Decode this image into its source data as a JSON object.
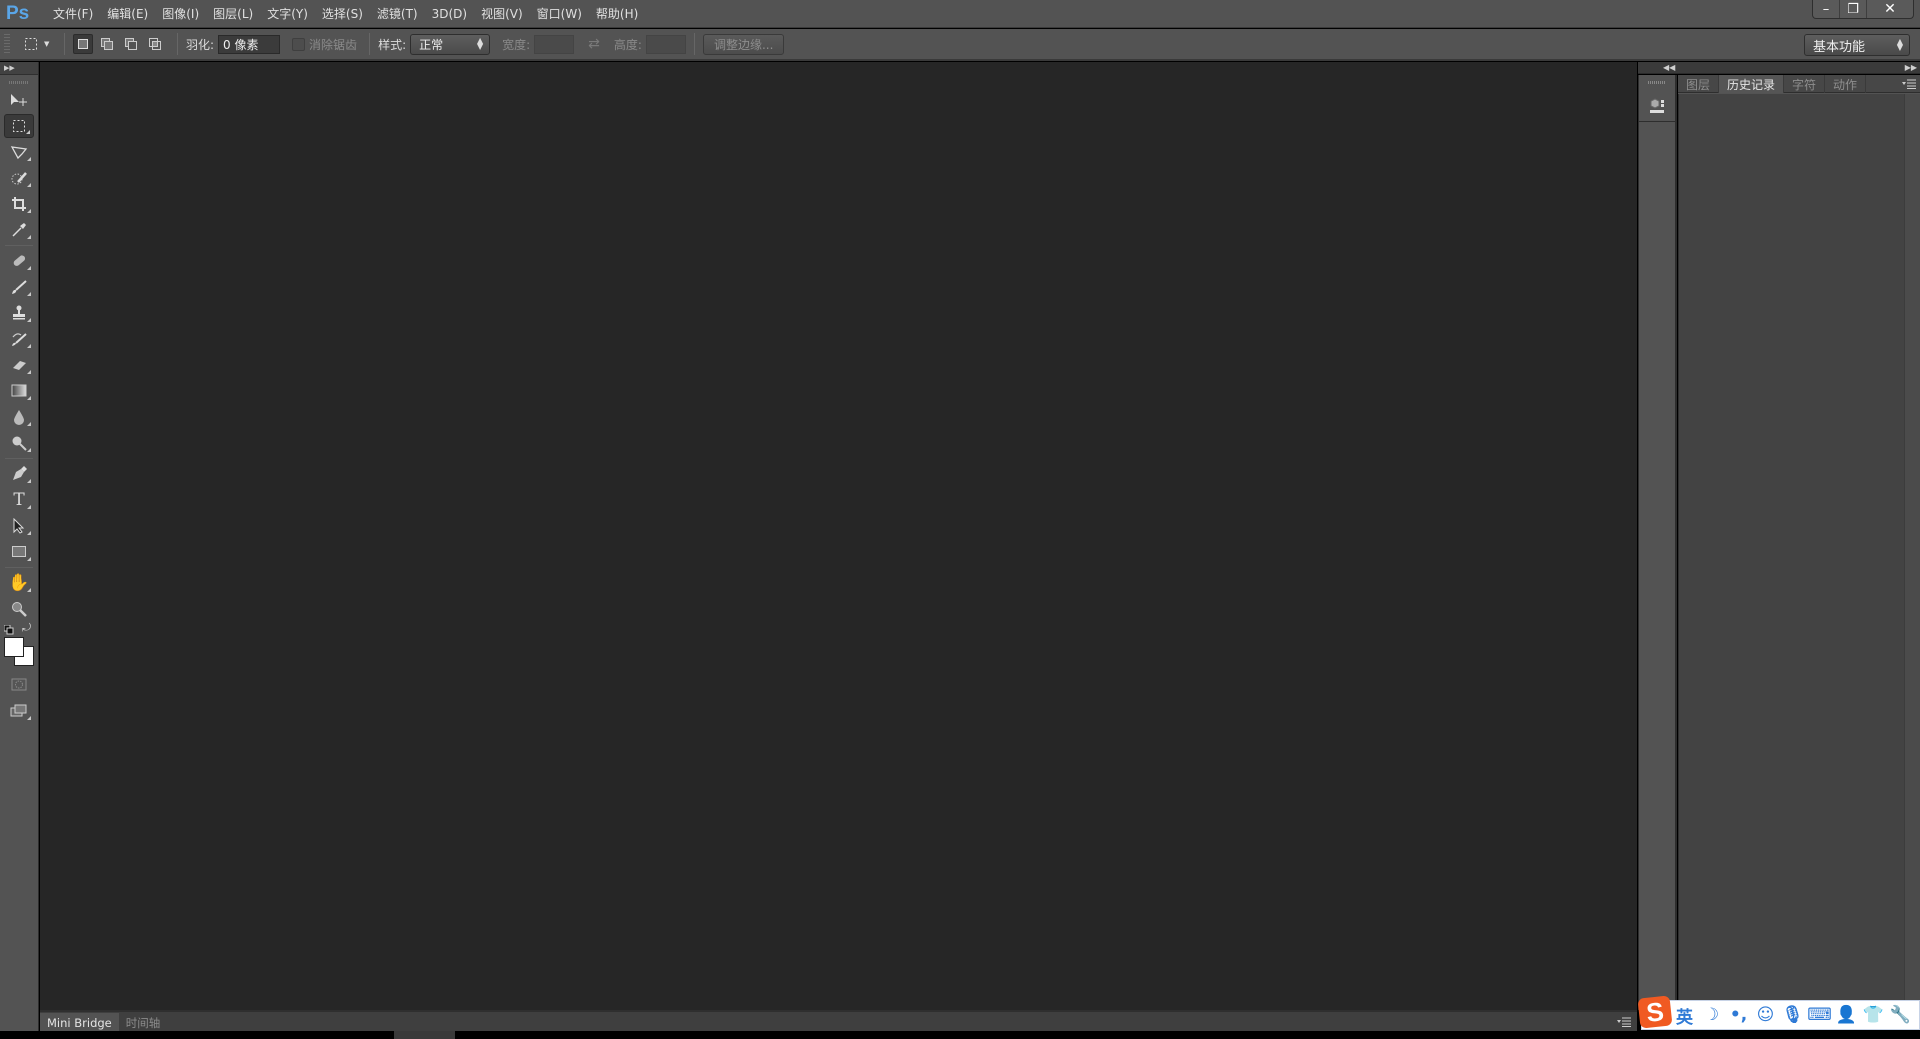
{
  "app": {
    "logo": "Ps",
    "name": "Adobe Photoshop"
  },
  "menubar": {
    "items": [
      "文件(F)",
      "编辑(E)",
      "图像(I)",
      "图层(L)",
      "文字(Y)",
      "选择(S)",
      "滤镜(T)",
      "3D(D)",
      "视图(V)",
      "窗口(W)",
      "帮助(H)"
    ]
  },
  "window_controls": {
    "minimize": "–",
    "restore": "❐",
    "close": "✕"
  },
  "options_bar": {
    "tool_preset_icon": "rect-marquee-icon",
    "selection_modes": [
      "new-selection",
      "add-to-selection",
      "subtract-from-selection",
      "intersect-with-selection"
    ],
    "active_mode": "new-selection",
    "feather_label": "羽化:",
    "feather_value": "0 像素",
    "antialias_label": "消除锯齿",
    "antialias_checked": false,
    "style_label": "样式:",
    "style_value": "正常",
    "width_label": "宽度:",
    "width_value": "",
    "height_label": "高度:",
    "height_value": "",
    "refine_edge_label": "调整边缘..."
  },
  "workspace": {
    "value": "基本功能"
  },
  "toolbox": {
    "tools": [
      {
        "name": "move-tool"
      },
      {
        "name": "rect-marquee-tool",
        "active": true
      },
      {
        "name": "lasso-tool"
      },
      {
        "name": "quick-selection-tool"
      },
      {
        "name": "crop-tool"
      },
      {
        "name": "eyedropper-tool"
      },
      {
        "name": "spot-healing-tool"
      },
      {
        "name": "brush-tool"
      },
      {
        "name": "clone-stamp-tool"
      },
      {
        "name": "history-brush-tool"
      },
      {
        "name": "eraser-tool"
      },
      {
        "name": "gradient-tool"
      },
      {
        "name": "blur-tool"
      },
      {
        "name": "dodge-tool"
      },
      {
        "name": "pen-tool"
      },
      {
        "name": "type-tool"
      },
      {
        "name": "path-selection-tool"
      },
      {
        "name": "rectangle-tool"
      },
      {
        "name": "hand-tool"
      },
      {
        "name": "zoom-tool"
      }
    ],
    "foreground_color": "#ffffff",
    "background_color": "#ffffff"
  },
  "bottom_panel": {
    "tabs": [
      "Mini Bridge",
      "时间轴"
    ],
    "active_tab": "Mini Bridge"
  },
  "right_panel": {
    "tabs": [
      "图层",
      "历史记录",
      "字符",
      "动作"
    ],
    "active_tab": "历史记录"
  },
  "ime_bar": {
    "logo": "S",
    "items": [
      "英",
      "☽",
      "•,",
      "☺",
      "🎙",
      "⌨",
      "👤",
      "👕",
      "🔧"
    ],
    "item_names": [
      "language-toggle",
      "fullwidth-toggle",
      "punctuation-toggle",
      "emoji",
      "voice-input",
      "soft-keyboard",
      "user-account",
      "skin",
      "settings"
    ]
  },
  "colors": {
    "accent": "#5aa6e8",
    "chrome": "#535353",
    "canvas": "#262626",
    "ime_brand": "#f05a22",
    "ime_icon": "#2f7ad6"
  }
}
